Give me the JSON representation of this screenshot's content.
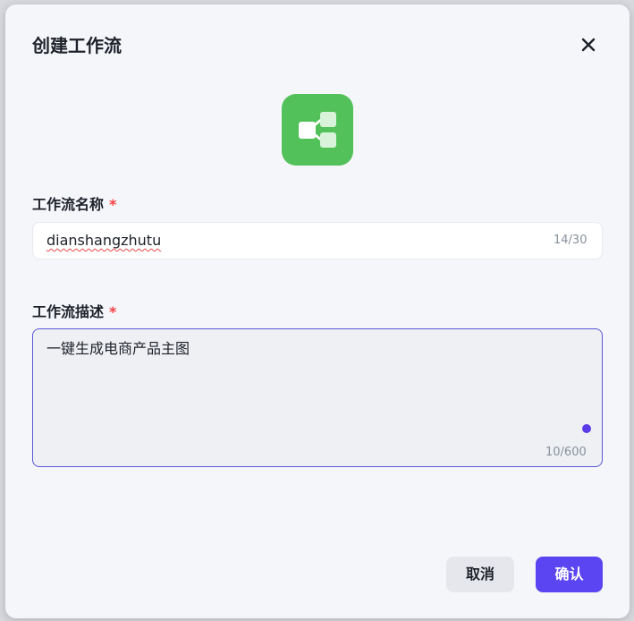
{
  "dialog": {
    "title": "创建工作流",
    "close_icon": "close-icon",
    "logo_icon": "workflow-icon",
    "logo_color": "#52c15a"
  },
  "name_field": {
    "label": "工作流名称",
    "required_mark": "*",
    "value": "dianshangzhutu",
    "counter": "14/30"
  },
  "description_field": {
    "label": "工作流描述",
    "required_mark": "*",
    "value": "一键生成电商产品主图",
    "counter": "10/600"
  },
  "buttons": {
    "cancel_label": "取消",
    "confirm_label": "确认",
    "confirm_color": "#5b44f2"
  }
}
